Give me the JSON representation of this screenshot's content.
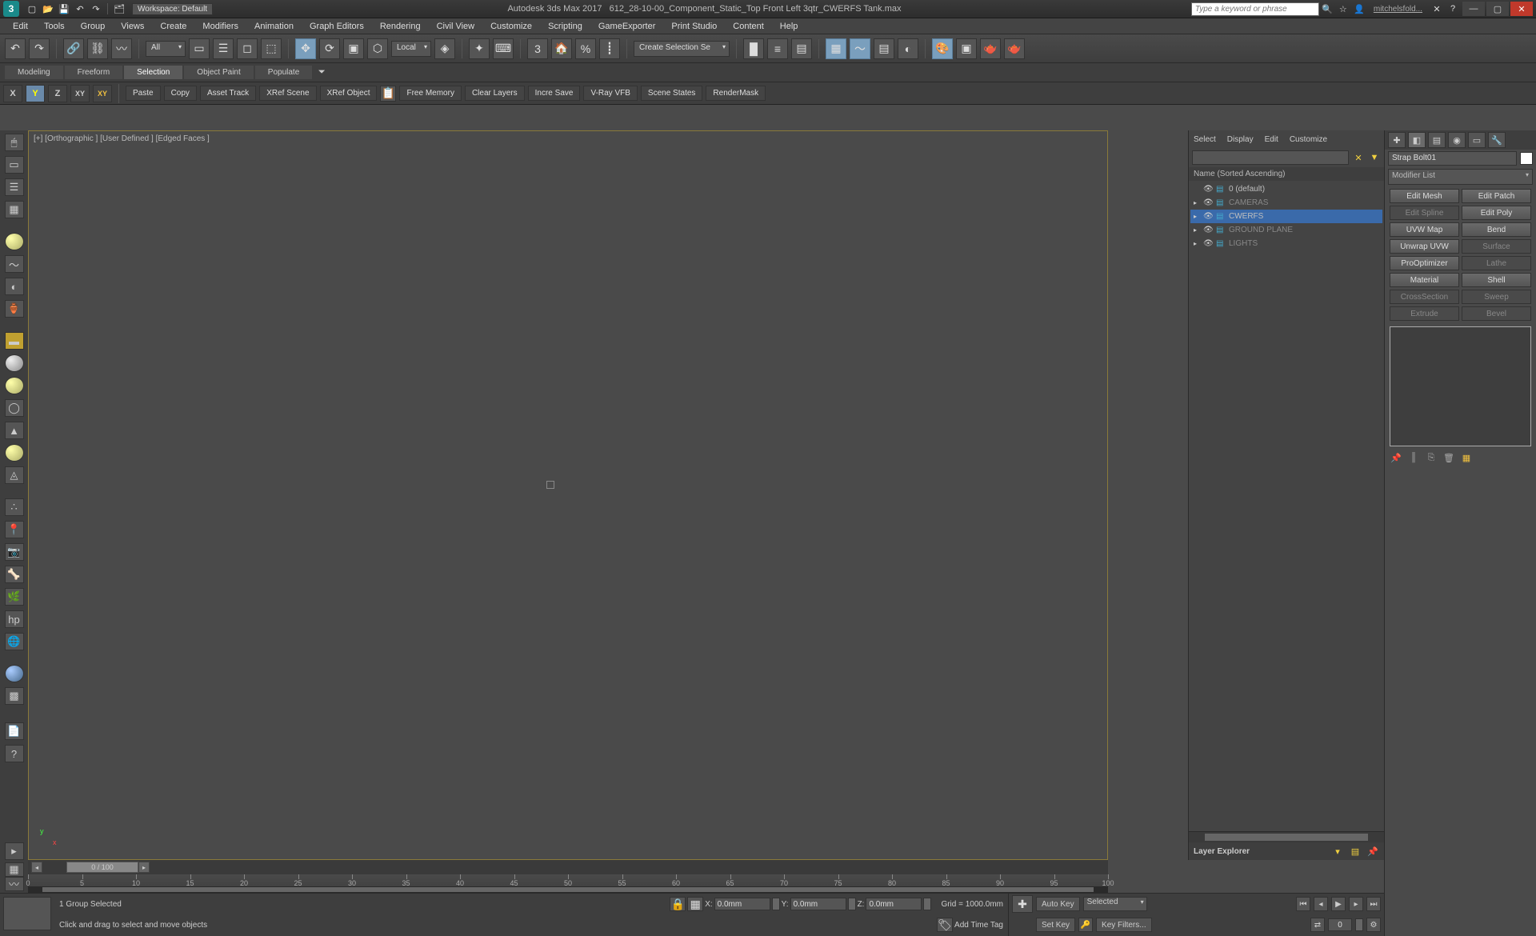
{
  "title_bar": {
    "logo_text": "3",
    "workspace_label": "Workspace: Default",
    "app_name": "Autodesk 3ds Max 2017",
    "file_name": "612_28-10-00_Component_Static_Top Front Left 3qtr_CWERFS Tank.max",
    "search_placeholder": "Type a keyword or phrase",
    "user_name": "mitchelsfold..."
  },
  "menu": [
    "Edit",
    "Tools",
    "Group",
    "Views",
    "Create",
    "Modifiers",
    "Animation",
    "Graph Editors",
    "Rendering",
    "Civil View",
    "Customize",
    "Scripting",
    "GameExporter",
    "Print Studio",
    "Content",
    "Help"
  ],
  "toolbar": {
    "filter_drop": "All",
    "refsys_drop": "Local",
    "selset_drop": "Create Selection Se"
  },
  "ribbon_tabs": [
    "Modeling",
    "Freeform",
    "Selection",
    "Object Paint",
    "Populate"
  ],
  "ribbon_active": 2,
  "axis": {
    "x": "X",
    "y": "Y",
    "z": "Z",
    "xy": "XY",
    "xy2": "XY"
  },
  "script_buttons": [
    "Paste",
    "Copy",
    "Asset Track",
    "XRef Scene",
    "XRef Object",
    "Free Memory",
    "Clear Layers",
    "Incre Save",
    "V-Ray VFB",
    "Scene States",
    "RenderMask"
  ],
  "viewport": {
    "label": "[+] [Orthographic ] [User Defined ] [Edged Faces ]"
  },
  "scene_explorer": {
    "menus": [
      "Select",
      "Display",
      "Edit",
      "Customize"
    ],
    "header": "Name (Sorted Ascending)",
    "rows": [
      {
        "name": "0 (default)",
        "dim": false,
        "selected": false,
        "indent": 0,
        "expandable": false
      },
      {
        "name": "CAMERAS",
        "dim": true,
        "selected": false,
        "indent": 0,
        "expandable": true
      },
      {
        "name": "CWERFS",
        "dim": false,
        "selected": true,
        "indent": 0,
        "expandable": true
      },
      {
        "name": "GROUND PLANE",
        "dim": true,
        "selected": false,
        "indent": 0,
        "expandable": true
      },
      {
        "name": "LIGHTS",
        "dim": true,
        "selected": false,
        "indent": 0,
        "expandable": true
      }
    ],
    "footer_label": "Layer Explorer"
  },
  "command_panel": {
    "object_name": "Strap Bolt01",
    "modlist_label": "Modifier List",
    "buttons": [
      {
        "label": "Edit Mesh",
        "disabled": false
      },
      {
        "label": "Edit Patch",
        "disabled": false
      },
      {
        "label": "Edit Spline",
        "disabled": true
      },
      {
        "label": "Edit Poly",
        "disabled": false
      },
      {
        "label": "UVW Map",
        "disabled": false
      },
      {
        "label": "Bend",
        "disabled": false
      },
      {
        "label": "Unwrap UVW",
        "disabled": false
      },
      {
        "label": "Surface",
        "disabled": true
      },
      {
        "label": "ProOptimizer",
        "disabled": false
      },
      {
        "label": "Lathe",
        "disabled": true
      },
      {
        "label": "Material",
        "disabled": false
      },
      {
        "label": "Shell",
        "disabled": false
      },
      {
        "label": "CrossSection",
        "disabled": true
      },
      {
        "label": "Sweep",
        "disabled": true
      },
      {
        "label": "Extrude",
        "disabled": true
      },
      {
        "label": "Bevel",
        "disabled": true
      }
    ]
  },
  "timeline": {
    "slider_label": "0 / 100",
    "ticks": [
      0,
      5,
      10,
      15,
      20,
      25,
      30,
      35,
      40,
      45,
      50,
      55,
      60,
      65,
      70,
      75,
      80,
      85,
      90,
      95,
      100
    ]
  },
  "status": {
    "selection": "1 Group Selected",
    "prompt": "Click and drag to select and move objects",
    "x_label": "X:",
    "x_val": "0.0mm",
    "y_label": "Y:",
    "y_val": "0.0mm",
    "z_label": "Z:",
    "z_val": "0.0mm",
    "grid_label": "Grid = 1000.0mm",
    "add_tag": "Add Time Tag"
  },
  "anim": {
    "autokey": "Auto Key",
    "setkey": "Set Key",
    "selected_drop": "Selected",
    "keyfilters": "Key Filters...",
    "frame": "0"
  }
}
